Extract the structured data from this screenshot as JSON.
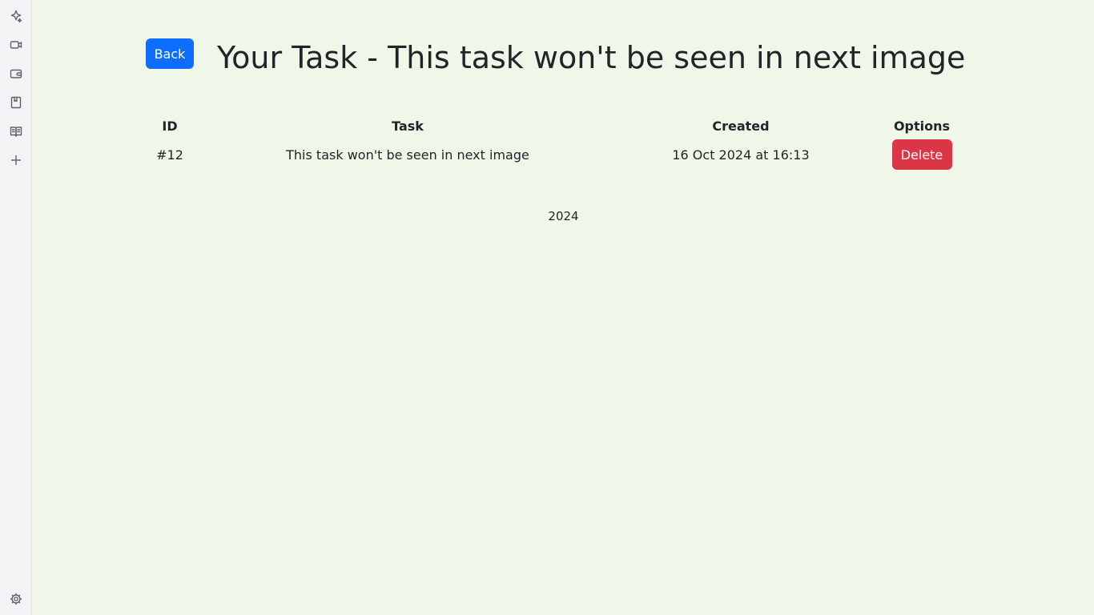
{
  "sidebar": {
    "icons": [
      "sparkle-icon",
      "video-icon",
      "wallet-icon",
      "bookmark-icon",
      "book-icon",
      "plus-icon"
    ],
    "bottom_icon": "gear-icon"
  },
  "header": {
    "back_label": "Back",
    "title": "Your Task - This task won't be seen in next image"
  },
  "table": {
    "columns": [
      "ID",
      "Task",
      "Created",
      "Options"
    ],
    "rows": [
      {
        "id": "#12",
        "task": "This task won't be seen in next image",
        "created": "16 Oct 2024 at 16:13",
        "delete_label": "Delete"
      }
    ]
  },
  "footer": {
    "year": "2024"
  },
  "colors": {
    "background": "#f1f7e8",
    "primary": "#0d6efd",
    "danger": "#dc3545",
    "sidebar": "#f3f4f6"
  }
}
